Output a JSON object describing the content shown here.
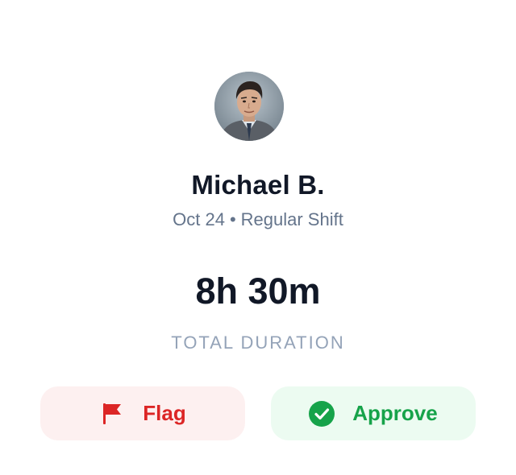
{
  "employee": {
    "name": "Michael B.",
    "date": "Oct 24",
    "separator": "•",
    "shift_type": "Regular Shift",
    "avatar_icon": "person-photo"
  },
  "summary": {
    "duration": "8h 30m",
    "duration_label": "TOTAL DURATION"
  },
  "actions": {
    "flag_label": "Flag",
    "flag_icon": "flag-icon",
    "approve_label": "Approve",
    "approve_icon": "check-circle-icon"
  },
  "colors": {
    "flag_text": "#dc2626",
    "flag_bg": "#fdf0f0",
    "approve_text": "#16a34a",
    "approve_bg": "#ecfbf1",
    "title_text": "#111827",
    "muted_text": "#64748b"
  }
}
